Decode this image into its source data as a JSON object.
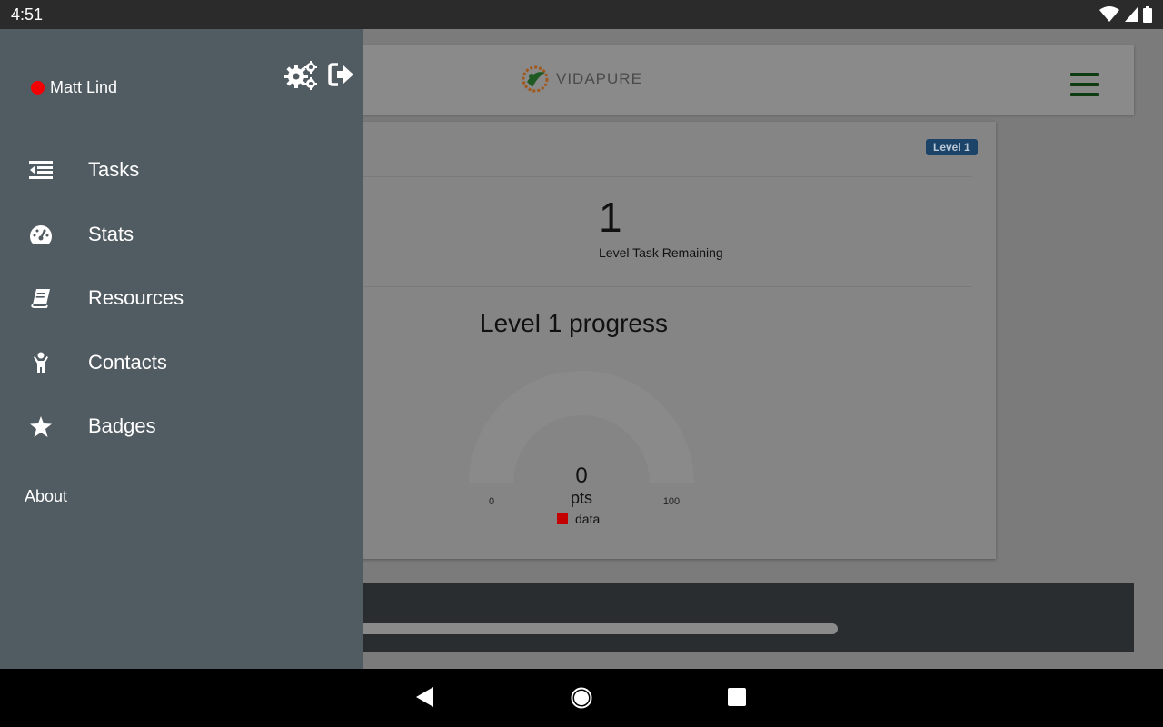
{
  "statusbar": {
    "time": "4:51"
  },
  "header": {
    "logo_text": "VIDAPURE"
  },
  "card": {
    "level_badge": "Level 1",
    "remaining_count": "1",
    "remaining_label": "Level Task Remaining",
    "progress_title": "Level 1 progress"
  },
  "chart_data": {
    "type": "gauge",
    "value": 0,
    "value_label": "0",
    "unit": "pts",
    "min": 0,
    "max": 100,
    "min_label": "0",
    "max_label": "100",
    "legend": "data",
    "legend_color": "#c40000",
    "track_color": "#8a8a8a"
  },
  "drawer": {
    "user_name": "Matt Lind",
    "user_status_color": "#f40000",
    "items": [
      {
        "label": "Tasks",
        "icon": "tasks-icon"
      },
      {
        "label": "Stats",
        "icon": "dashboard-icon"
      },
      {
        "label": "Resources",
        "icon": "book-icon"
      },
      {
        "label": "Contacts",
        "icon": "person-icon"
      },
      {
        "label": "Badges",
        "icon": "star-icon"
      }
    ],
    "about_label": "About"
  },
  "colors": {
    "drawer_bg": "#515b62",
    "scrim_bg": "#7b7b7b",
    "hamburger": "#0e3b12",
    "badge_bg": "#1c4469"
  }
}
